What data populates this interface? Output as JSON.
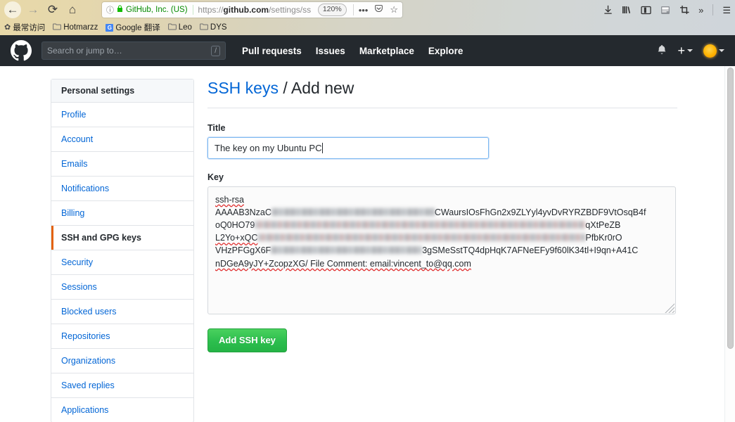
{
  "browser": {
    "back_icon": "←",
    "forward_icon": "→",
    "reload_icon": "⟳",
    "home_icon": "⌂",
    "identity_icon": "ⓘ",
    "lock_icon": "🔒",
    "site_identity": "GitHub, Inc. (US)",
    "url_protocol": "https://",
    "url_domain": "github.com",
    "url_path": "/settings/ssh/new",
    "zoom_level": "120%",
    "page_actions_icon": "•••",
    "pocket_icon": "♡",
    "bookmark_star_icon": "☆",
    "toolbar_icons": [
      {
        "name": "downloads-icon",
        "glyph": "⤓"
      },
      {
        "name": "library-icon",
        "glyph": "|||\\"
      },
      {
        "name": "sidebar-icon",
        "glyph": "▯"
      },
      {
        "name": "screenshot-icon",
        "glyph": "Se"
      },
      {
        "name": "clip-icon",
        "glyph": "⛶"
      },
      {
        "name": "overflow-icon",
        "glyph": "»"
      },
      {
        "name": "menu-icon",
        "glyph": "☰"
      }
    ],
    "bookmarks": [
      {
        "name": "bookmark-most-visited",
        "icon": "✿",
        "label": "最常访问"
      },
      {
        "name": "bookmark-hotmarzz",
        "icon": "📁",
        "label": "Hotmarzz"
      },
      {
        "name": "bookmark-google-translate",
        "icon": "G",
        "label": "Google 翻译"
      },
      {
        "name": "bookmark-leo",
        "icon": "📁",
        "label": "Leo"
      },
      {
        "name": "bookmark-dys",
        "icon": "📁",
        "label": "DYS"
      }
    ]
  },
  "github_header": {
    "search_placeholder": "Search or jump to…",
    "slash_hint": "/",
    "nav": [
      {
        "name": "nav-pull-requests",
        "label": "Pull requests"
      },
      {
        "name": "nav-issues",
        "label": "Issues"
      },
      {
        "name": "nav-marketplace",
        "label": "Marketplace"
      },
      {
        "name": "nav-explore",
        "label": "Explore"
      }
    ],
    "bell_icon": "🔔",
    "plus_icon": "+"
  },
  "sidebar": {
    "heading": "Personal settings",
    "items": [
      {
        "label": "Profile",
        "active": false
      },
      {
        "label": "Account",
        "active": false
      },
      {
        "label": "Emails",
        "active": false
      },
      {
        "label": "Notifications",
        "active": false
      },
      {
        "label": "Billing",
        "active": false
      },
      {
        "label": "SSH and GPG keys",
        "active": true
      },
      {
        "label": "Security",
        "active": false
      },
      {
        "label": "Sessions",
        "active": false
      },
      {
        "label": "Blocked users",
        "active": false
      },
      {
        "label": "Repositories",
        "active": false
      },
      {
        "label": "Organizations",
        "active": false
      },
      {
        "label": "Saved replies",
        "active": false
      },
      {
        "label": "Applications",
        "active": false
      }
    ]
  },
  "main": {
    "title_link": "SSH keys",
    "title_separator": " / ",
    "title_current": "Add new",
    "title_field_label": "Title",
    "title_field_value": "The key on my Ubuntu PC",
    "key_field_label": "Key",
    "key_lines": [
      {
        "prefix": "ssh-rsa",
        "suffix": "",
        "blur_width": 0
      },
      {
        "prefix": "AAAAB3NzaC",
        "suffix": "CWaursIOsFhGn2x9ZLYyl4yvDvRYRZBDF9VtOsqB4f",
        "blur_width": 232
      },
      {
        "prefix": "oQ0HO79",
        "suffix": "qXtPeZB",
        "blur_width": 470
      },
      {
        "prefix": "L2Yo+xQC",
        "suffix": "PfbKr0rO",
        "blur_width": 466
      },
      {
        "prefix": "VHzPFGgX6F",
        "suffix": "3gSMeSstTQ4dpHqK7AFNeEFy9f60lK34tl+I9qn+A41C",
        "blur_width": 215
      },
      {
        "prefix": "nDGeA9yJY+ZcopzXG/ File Comment: email:vincent_to@qq.com",
        "suffix": "",
        "blur_width": 0
      }
    ],
    "submit_label": "Add SSH key"
  },
  "colors": {
    "github_dark": "#24292e",
    "link_blue": "#0366d6",
    "accent_orange": "#e36209",
    "button_green": "#2cbe4e"
  }
}
